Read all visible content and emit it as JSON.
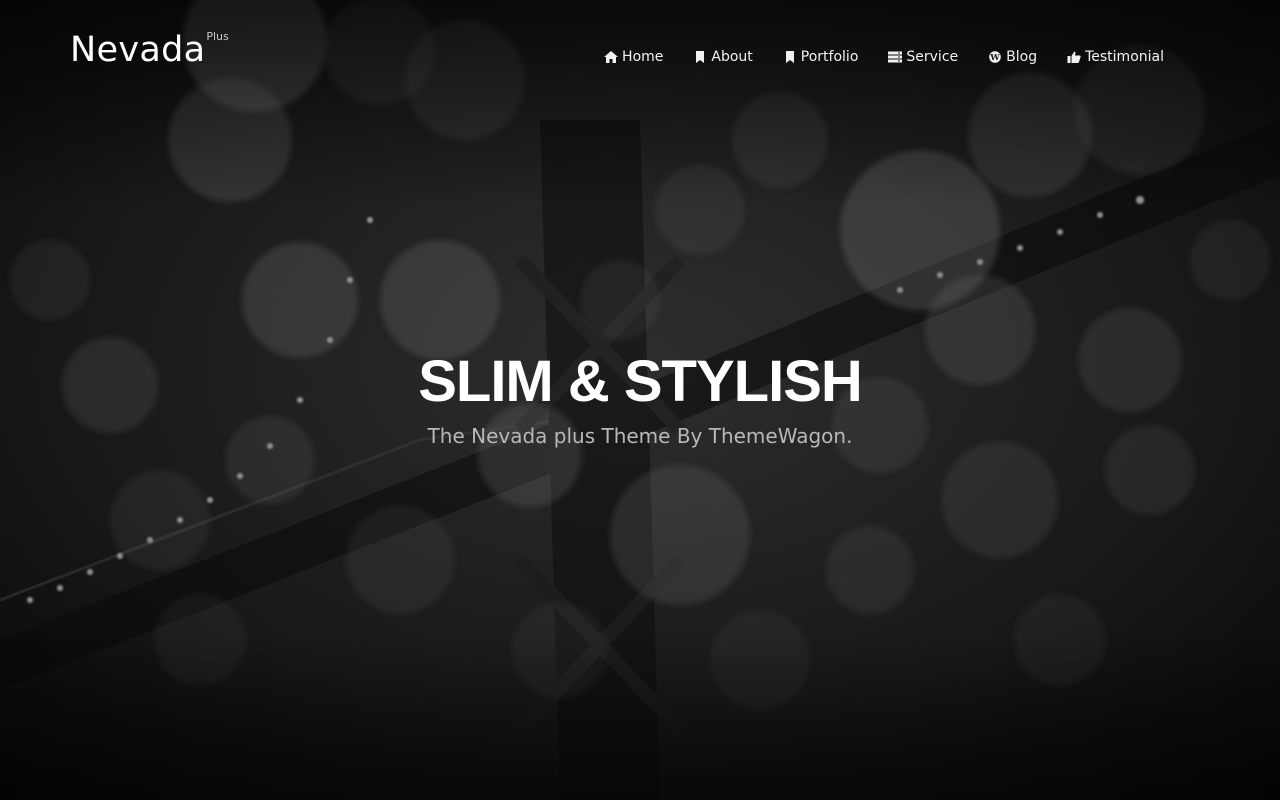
{
  "brand": {
    "name": "Nevada",
    "sup": "Plus"
  },
  "nav": {
    "items": [
      {
        "label": "Home",
        "icon": "home-icon"
      },
      {
        "label": "About",
        "icon": "bookmark-icon"
      },
      {
        "label": "Portfolio",
        "icon": "bookmark-icon"
      },
      {
        "label": "Service",
        "icon": "server-icon"
      },
      {
        "label": "Blog",
        "icon": "wordpress-icon"
      },
      {
        "label": "Testimonial",
        "icon": "thumbs-up-icon"
      }
    ]
  },
  "hero": {
    "title": "SLIM & STYLISH",
    "subtitle": "The Nevada plus Theme By ThemeWagon."
  },
  "colors": {
    "background": "#0c0c0c",
    "text": "#ffffff",
    "subtitle": "#b8b8b8"
  }
}
